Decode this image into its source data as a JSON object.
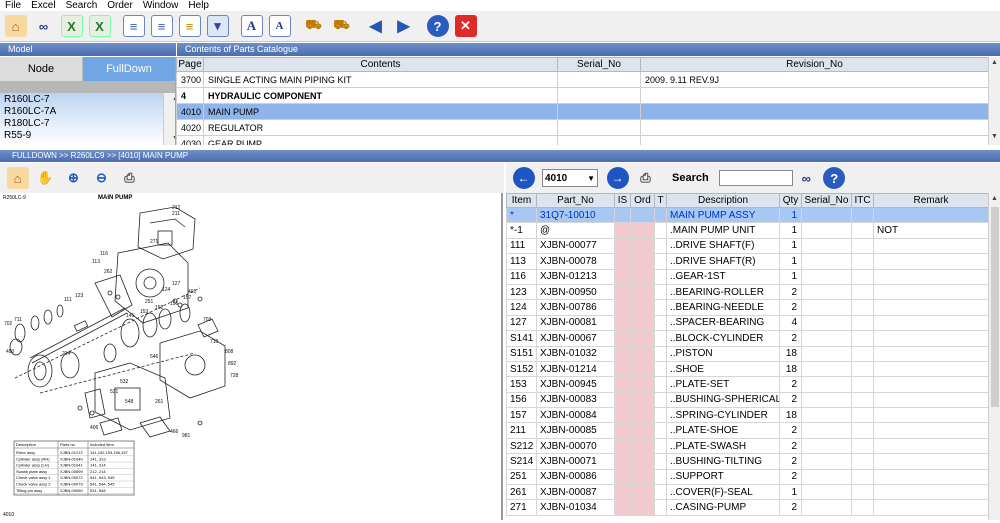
{
  "menu": [
    "File",
    "Excel",
    "Search",
    "Order",
    "Window",
    "Help"
  ],
  "toolbar_icons": [
    "home-icon",
    "binoculars-icon",
    "excel-export-icon",
    "excel-import-icon",
    "list-icon",
    "list-add-icon",
    "list-check-icon",
    "save-icon",
    "font-increase-icon",
    "font-decrease-icon",
    "cart-add-icon",
    "cart-icon",
    "arrow-left-icon",
    "arrow-right-icon",
    "help-icon",
    "close-icon"
  ],
  "model_panel": {
    "header": "Model",
    "tab_node": "Node",
    "tab_fulldown": "FullDown",
    "items": [
      "R160LC-7",
      "R160LC-7A",
      "R180LC-7",
      "R55-9"
    ]
  },
  "contents": {
    "header": "Contents of Parts Catalogue",
    "columns": [
      "Page",
      "Contents",
      "Serial_No",
      "Revision_No"
    ],
    "rows": [
      {
        "page": "3700",
        "contents": "SINGLE ACTING MAIN PIPING KIT",
        "serial": "",
        "revision": "2009. 9.11 REV.9J",
        "style": ""
      },
      {
        "page": "4",
        "contents": "HYDRAULIC COMPONENT",
        "serial": "",
        "revision": "",
        "style": "bold"
      },
      {
        "page": "4010",
        "contents": "MAIN PUMP",
        "serial": "",
        "revision": "",
        "style": "sel"
      },
      {
        "page": "4020",
        "contents": "REGULATOR",
        "serial": "",
        "revision": "",
        "style": ""
      },
      {
        "page": "4030",
        "contents": "GEAR PUMP",
        "serial": "",
        "revision": "",
        "style": ""
      }
    ]
  },
  "breadcrumb": "FULLDOWN >> R260LC9 >> [4010] MAIN PUMP",
  "diagram": {
    "model_label": "R250LC-9",
    "title": "MAIN PUMP",
    "page_label": "4010",
    "callouts": [
      "212",
      "211",
      "116",
      "113",
      "271",
      "262",
      "251",
      "124",
      "127",
      "401",
      "141",
      "153",
      "152",
      "156",
      "157",
      "703",
      "710",
      "808",
      "892",
      "728",
      "546",
      "214",
      "532",
      "531",
      "548",
      "261",
      "406",
      "490",
      "111",
      "123",
      "702",
      "711",
      "466",
      "981"
    ],
    "legend": {
      "columns": [
        "Description",
        "Parts no",
        "Included item"
      ],
      "rows": [
        [
          "Rotor assy",
          "XJBN-01212",
          "141,152,153,156,157"
        ],
        [
          "Cylinder assy (RH)",
          "XJBN-01040",
          "141, 313"
        ],
        [
          "Cylinder assy (LH)",
          "XJBN-01041",
          "141, 314"
        ],
        [
          "Swash plate assy",
          "XJBN-00899",
          "212, 214"
        ],
        [
          "Check valve assy 1",
          "XJBN-00072",
          "541, 543, 545"
        ],
        [
          "Check valve assy 2",
          "XJBN-00079",
          "541, 544, 545"
        ],
        [
          "Tilting pin assy",
          "XJBN-00060",
          "531, 548"
        ]
      ]
    }
  },
  "parts_toolbar": {
    "page_value": "4010",
    "search_label": "Search",
    "search_value": ""
  },
  "parts": {
    "columns": [
      "Item",
      "Part_No",
      "IS",
      "Ord",
      "T",
      "Description",
      "Qty",
      "Serial_No",
      "ITC",
      "Remark"
    ],
    "rows": [
      [
        "*",
        "31Q7-10010",
        "",
        "",
        "",
        "MAIN PUMP ASSY",
        "1",
        "",
        "",
        ""
      ],
      [
        "*-1",
        "@",
        "",
        "",
        "",
        ".MAIN PUMP UNIT",
        "1",
        "",
        "",
        "NOT"
      ],
      [
        "111",
        "XJBN-00077",
        "",
        "",
        "",
        "..DRIVE SHAFT(F)",
        "1",
        "",
        "",
        ""
      ],
      [
        "113",
        "XJBN-00078",
        "",
        "",
        "",
        "..DRIVE SHAFT(R)",
        "1",
        "",
        "",
        ""
      ],
      [
        "116",
        "XJBN-01213",
        "",
        "",
        "",
        "..GEAR-1ST",
        "1",
        "",
        "",
        ""
      ],
      [
        "123",
        "XJBN-00950",
        "",
        "",
        "",
        "..BEARING-ROLLER",
        "2",
        "",
        "",
        ""
      ],
      [
        "124",
        "XJBN-00786",
        "",
        "",
        "",
        "..BEARING-NEEDLE",
        "2",
        "",
        "",
        ""
      ],
      [
        "127",
        "XJBN-00081",
        "",
        "",
        "",
        "..SPACER-BEARING",
        "4",
        "",
        "",
        ""
      ],
      [
        "S141",
        "XJBN-00067",
        "",
        "",
        "",
        "..BLOCK-CYLINDER",
        "2",
        "",
        "",
        ""
      ],
      [
        "S151",
        "XJBN-01032",
        "",
        "",
        "",
        "..PISTON",
        "18",
        "",
        "",
        ""
      ],
      [
        "S152",
        "XJBN-01214",
        "",
        "",
        "",
        "..SHOE",
        "18",
        "",
        "",
        ""
      ],
      [
        "153",
        "XJBN-00945",
        "",
        "",
        "",
        "..PLATE-SET",
        "2",
        "",
        "",
        ""
      ],
      [
        "156",
        "XJBN-00083",
        "",
        "",
        "",
        "..BUSHING-SPHERICAL",
        "2",
        "",
        "",
        ""
      ],
      [
        "157",
        "XJBN-00084",
        "",
        "",
        "",
        "..SPRING-CYLINDER",
        "18",
        "",
        "",
        ""
      ],
      [
        "211",
        "XJBN-00085",
        "",
        "",
        "",
        "..PLATE-SHOE",
        "2",
        "",
        "",
        ""
      ],
      [
        "S212",
        "XJBN-00070",
        "",
        "",
        "",
        "..PLATE-SWASH",
        "2",
        "",
        "",
        ""
      ],
      [
        "S214",
        "XJBN-00071",
        "",
        "",
        "",
        "..BUSHING-TILTING",
        "2",
        "",
        "",
        ""
      ],
      [
        "251",
        "XJBN-00086",
        "",
        "",
        "",
        "..SUPPORT",
        "2",
        "",
        "",
        ""
      ],
      [
        "261",
        "XJBN-00087",
        "",
        "",
        "",
        "..COVER(F)-SEAL",
        "1",
        "",
        "",
        ""
      ],
      [
        "271",
        "XJBN-01034",
        "",
        "",
        "",
        "..CASING-PUMP",
        "2",
        "",
        "",
        ""
      ]
    ]
  }
}
